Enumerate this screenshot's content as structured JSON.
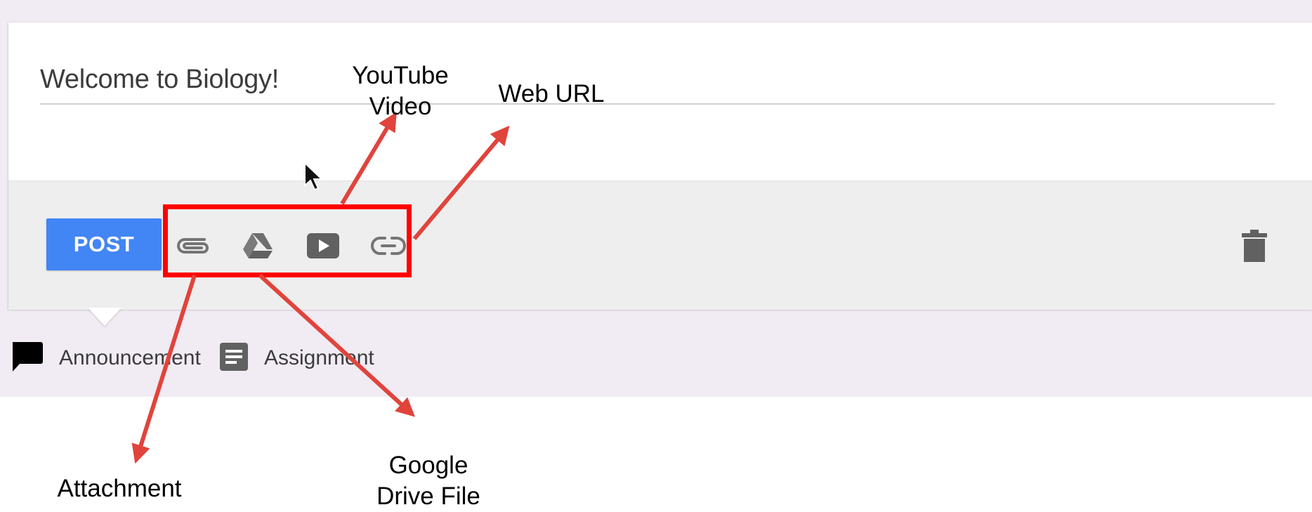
{
  "composer": {
    "title_value": "Welcome to Biology!",
    "post_label": "POST",
    "tools": [
      {
        "icon": "paperclip-icon"
      },
      {
        "icon": "google-drive-icon"
      },
      {
        "icon": "youtube-icon"
      },
      {
        "icon": "link-icon"
      }
    ],
    "delete_icon": "trash-icon"
  },
  "stream_tabs": [
    {
      "label": "Announcement",
      "icon": "announcement-icon"
    },
    {
      "label": "Assignment",
      "icon": "assignment-icon"
    }
  ],
  "annotations": {
    "youtube": {
      "line1": "YouTube",
      "line2": "Video"
    },
    "web_url": "Web URL",
    "attachment": "Attachment",
    "drive": {
      "line1": "Google",
      "line2": "Drive File"
    },
    "arrow_color": "#e0443c",
    "box_color": "#ff0000"
  },
  "colors": {
    "post_button": "#4285f4",
    "stream_background": "#f1ebf3",
    "toolbar_background": "#eeeeee"
  }
}
